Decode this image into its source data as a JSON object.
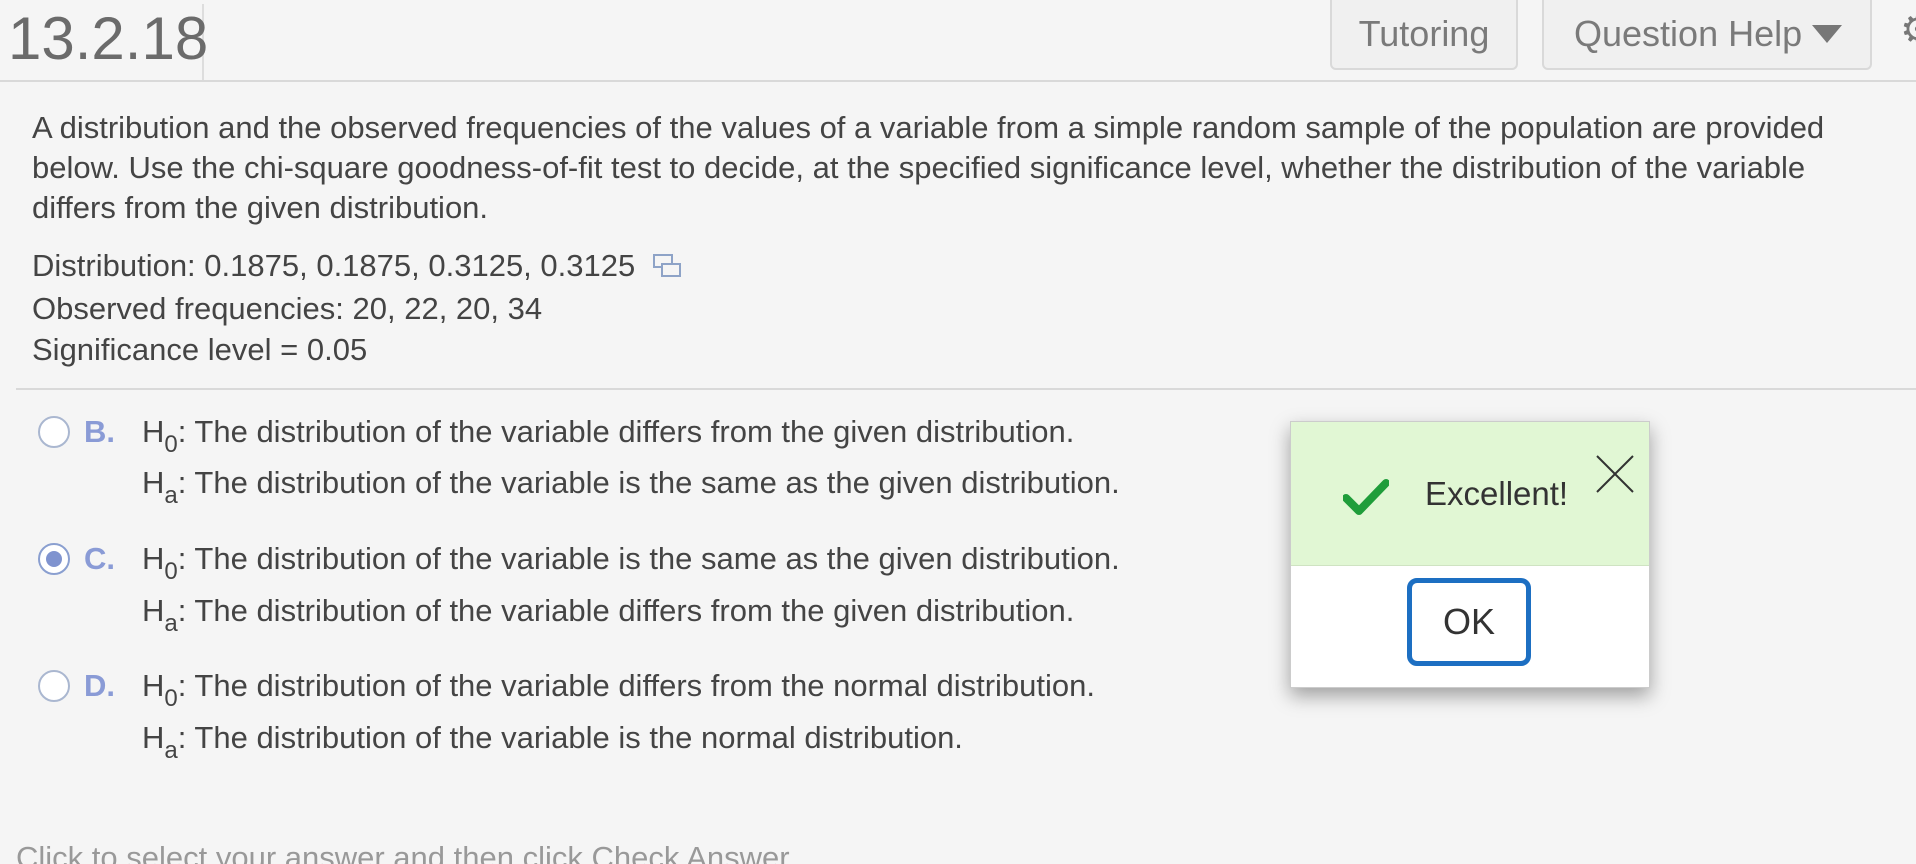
{
  "header": {
    "question_number": "13.2.18",
    "tutoring_label": "Tutoring",
    "question_help_label": "Question Help"
  },
  "problem": {
    "statement_lines": [
      "A distribution and the observed frequencies of the values of a variable from a simple random sample of the population are provided",
      "below. Use the chi-square goodness-of-fit test to decide, at the specified significance level, whether the distribution of the variable",
      "differs from the given distribution."
    ],
    "distribution": "Distribution: 0.1875, 0.1875, 0.3125, 0.3125",
    "observed": "Observed frequencies: 20, 22, 20, 34",
    "significance": "Significance level = 0.05"
  },
  "options": [
    {
      "letter": "B.",
      "selected": false,
      "h0": ": The distribution of the variable differs from the given distribution.",
      "ha": ": The distribution of the variable is the same as the given distribution."
    },
    {
      "letter": "C.",
      "selected": true,
      "h0": ": The distribution of the variable is the same as the given distribution.",
      "ha": ": The distribution of the variable differs from the given distribution."
    },
    {
      "letter": "D.",
      "selected": false,
      "h0": ": The distribution of the variable differs from the normal distribution.",
      "ha": ": The distribution of the variable is the normal distribution."
    }
  ],
  "hypothesis": {
    "h": "H",
    "sub_0": "0",
    "sub_a": "a"
  },
  "footer_hint": "Click to select your answer and then click Check Answer.",
  "dialog": {
    "message": "Excellent!",
    "ok_label": "OK",
    "success_color": "#1f9d3a",
    "accent_color": "#1d6fc2"
  }
}
